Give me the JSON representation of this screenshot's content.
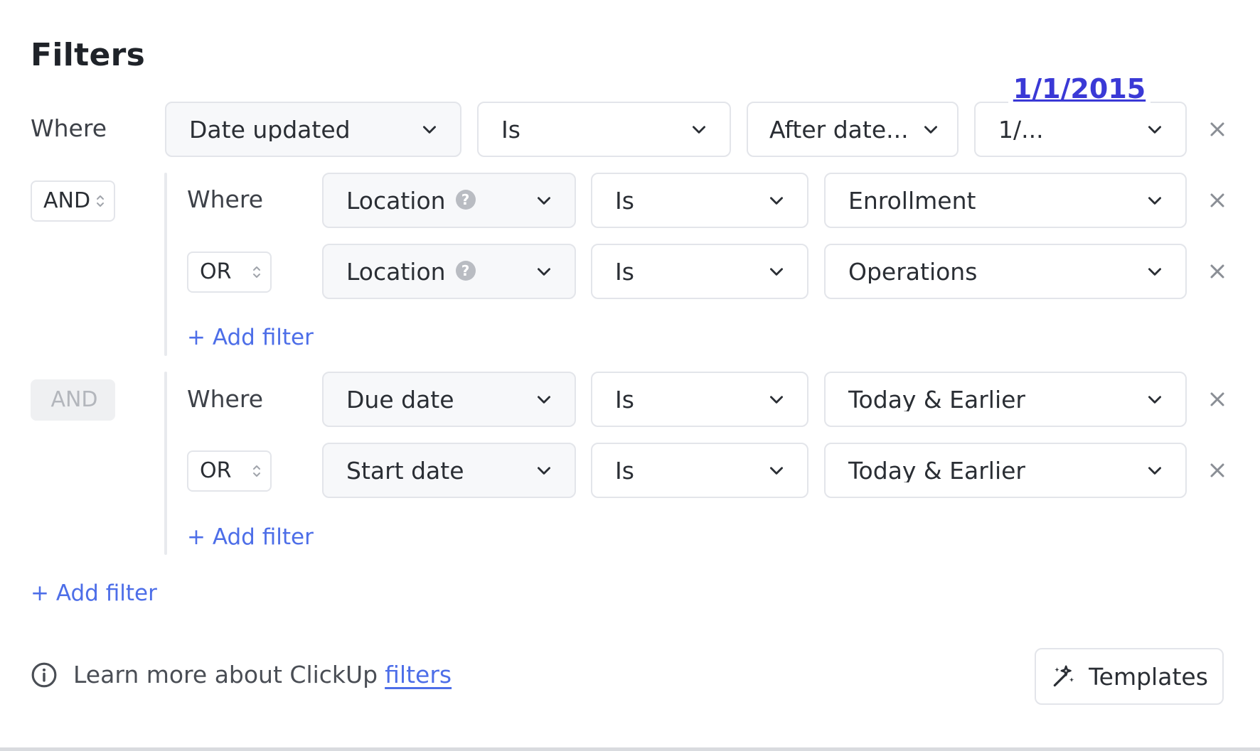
{
  "title": "Filters",
  "overlay_value": "1/1/2015",
  "labels": {
    "where": "Where"
  },
  "row0": {
    "field": "Date updated",
    "operator": "Is",
    "condition": "After date...",
    "value": "1/..."
  },
  "group1": {
    "logic": "AND",
    "row1": {
      "field": "Location",
      "operator": "Is",
      "value": "Enrollment"
    },
    "row2": {
      "logic": "OR",
      "field": "Location",
      "operator": "Is",
      "value": "Operations"
    },
    "add_filter": "+ Add filter"
  },
  "group2": {
    "logic": "AND",
    "row1": {
      "field": "Due date",
      "operator": "Is",
      "value": "Today & Earlier"
    },
    "row2": {
      "logic": "OR",
      "field": "Start date",
      "operator": "Is",
      "value": "Today & Earlier"
    },
    "add_filter": "+ Add filter"
  },
  "add_filter": "+ Add filter",
  "footer": {
    "learn_text": "Learn more about ClickUp",
    "learn_link": "filters",
    "templates_label": "Templates"
  },
  "icons": {
    "chevron": "chevron-down-icon",
    "close": "close-icon",
    "help": "question-circle-icon",
    "spinner": "up-down-arrows-icon",
    "info": "info-circle-icon",
    "templates": "magic-wand-icon"
  },
  "colors": {
    "link": "#4d6ee8",
    "overlay_link": "#3a39d6",
    "border": "#e3e5ea",
    "field_bg": "#f7f8fa"
  }
}
